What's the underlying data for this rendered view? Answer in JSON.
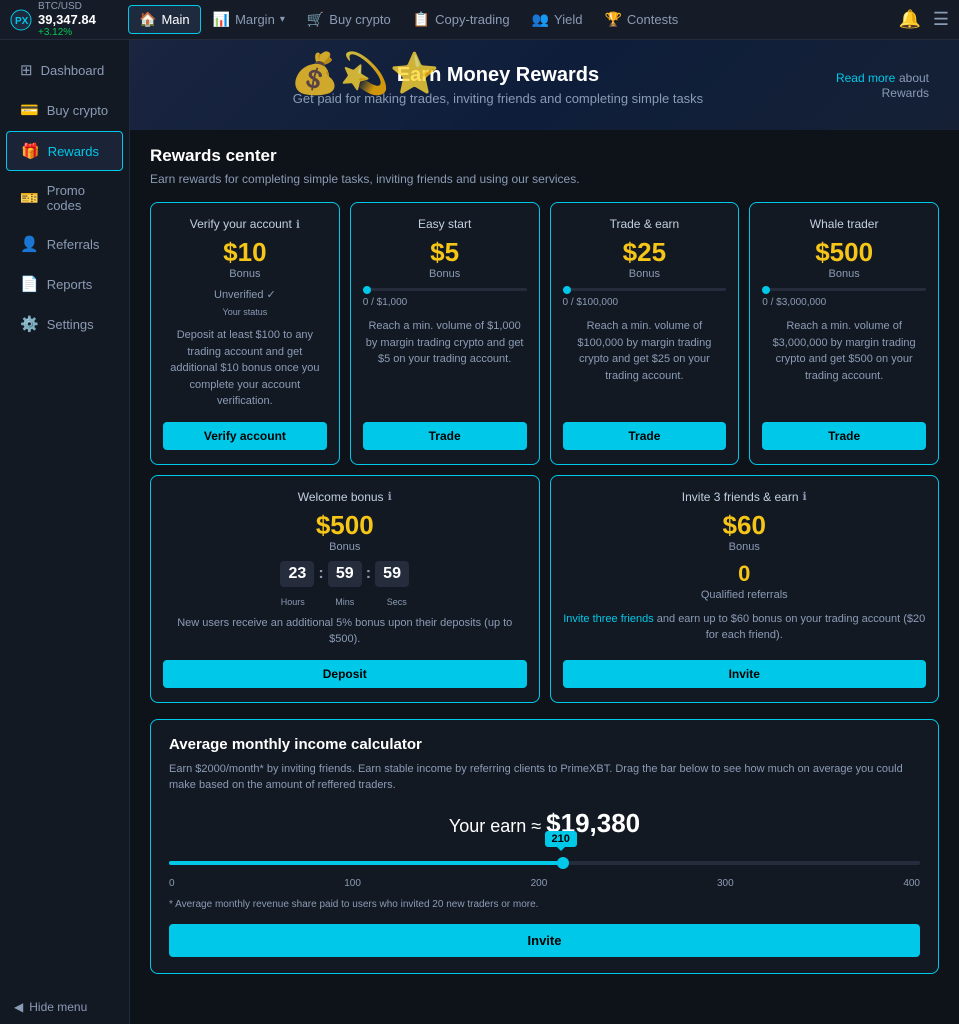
{
  "topNav": {
    "btc": {
      "pair": "BTC/USD",
      "price": "39,347.84",
      "change": "+3.12%"
    },
    "items": [
      {
        "id": "main",
        "label": "Main",
        "icon": "🏠",
        "active": true
      },
      {
        "id": "margin",
        "label": "Margin",
        "icon": "📊",
        "active": false,
        "hasDropdown": true
      },
      {
        "id": "buycrypto",
        "label": "Buy crypto",
        "icon": "🛒",
        "active": false
      },
      {
        "id": "copytrading",
        "label": "Copy-trading",
        "icon": "📋",
        "active": false
      },
      {
        "id": "yield",
        "label": "Yield",
        "icon": "👥",
        "active": false
      },
      {
        "id": "contests",
        "label": "Contests",
        "icon": "🏆",
        "active": false
      }
    ]
  },
  "sidebar": {
    "items": [
      {
        "id": "dashboard",
        "label": "Dashboard",
        "icon": "⊞",
        "active": false
      },
      {
        "id": "buycrypto",
        "label": "Buy crypto",
        "icon": "💳",
        "active": false
      },
      {
        "id": "rewards",
        "label": "Rewards",
        "icon": "⚙",
        "active": true
      },
      {
        "id": "promocodes",
        "label": "Promo codes",
        "icon": "🎫",
        "active": false
      },
      {
        "id": "referrals",
        "label": "Referrals",
        "icon": "👤",
        "active": false
      },
      {
        "id": "reports",
        "label": "Reports",
        "icon": "📄",
        "active": false
      },
      {
        "id": "settings",
        "label": "Settings",
        "icon": "⚙️",
        "active": false
      }
    ],
    "hideMenu": "Hide menu"
  },
  "banner": {
    "title": "Earn Money Rewards",
    "subtitle": "Get paid for making trades, inviting friends and completing simple tasks",
    "linkText": "Read more",
    "linkSuffix": " about\nRewards"
  },
  "rewardsCenter": {
    "title": "Rewards center",
    "description": "Earn rewards for completing simple tasks, inviting friends and using our services.",
    "cards": [
      {
        "id": "verify",
        "title": "Verify your account",
        "amount": "$10",
        "bonusLabel": "Bonus",
        "statusLabel": "Unverified",
        "desc": "Deposit at least $100 to any trading account and get additional $10 bonus once you complete your account verification.",
        "btnLabel": "Verify account",
        "showStatus": true,
        "showProgress": false
      },
      {
        "id": "easystart",
        "title": "Easy start",
        "amount": "$5",
        "bonusLabel": "Bonus",
        "progressValue": "0",
        "progressMax": "$1,000",
        "progressPercent": 0,
        "desc": "Reach a min. volume of $1,000 by margin trading crypto and get $5 on your trading account.",
        "btnLabel": "Trade",
        "showStatus": false,
        "showProgress": true
      },
      {
        "id": "tradeearn",
        "title": "Trade & earn",
        "amount": "$25",
        "bonusLabel": "Bonus",
        "progressValue": "0",
        "progressMax": "$100,000",
        "progressPercent": 0,
        "desc": "Reach a min. volume of $100,000 by margin trading crypto and get $25 on your trading account.",
        "btnLabel": "Trade",
        "showStatus": false,
        "showProgress": true
      },
      {
        "id": "whaletrader",
        "title": "Whale trader",
        "amount": "$500",
        "bonusLabel": "Bonus",
        "progressValue": "0",
        "progressMax": "$3,000,000",
        "progressPercent": 0,
        "desc": "Reach a min. volume of $3,000,000 by margin trading crypto and get $500 on your trading account.",
        "btnLabel": "Trade",
        "showStatus": false,
        "showProgress": true
      }
    ],
    "bottomCards": [
      {
        "id": "welcomebonus",
        "title": "Welcome bonus",
        "amount": "$500",
        "bonusLabel": "Bonus",
        "timer": {
          "hours": "23",
          "mins": "59",
          "secs": "59"
        },
        "desc": "New users receive an additional 5% bonus upon their deposits (up to $500).",
        "btnLabel": "Deposit",
        "showTimer": true
      },
      {
        "id": "invite3",
        "title": "Invite 3 friends & earn",
        "amount": "$60",
        "bonusLabel": "Bonus",
        "referrals": "0",
        "referralsLabel": "Qualified referrals",
        "inviteLink": "Invite three friends",
        "inviteDesc": " and earn up to $60 bonus on your trading account ($20 for each friend).",
        "btnLabel": "Invite",
        "showTimer": false
      }
    ]
  },
  "calculator": {
    "title": "Average monthly income calculator",
    "desc": "Earn $2000/month* by inviting friends. Earn stable income by referring clients to PrimeXBT. Drag the bar below to see how much on average you could make based on the amount of reffered traders.",
    "earnLabel": "Your earn ≈",
    "earnAmount": "$19,380",
    "sliderValue": 210,
    "sliderMin": 0,
    "sliderMax": 400,
    "marks": [
      "0",
      "100",
      "200",
      "300",
      "400"
    ],
    "footnote": "* Average monthly revenue share paid to users who invited 20 new traders or more.",
    "btnLabel": "Invite"
  }
}
